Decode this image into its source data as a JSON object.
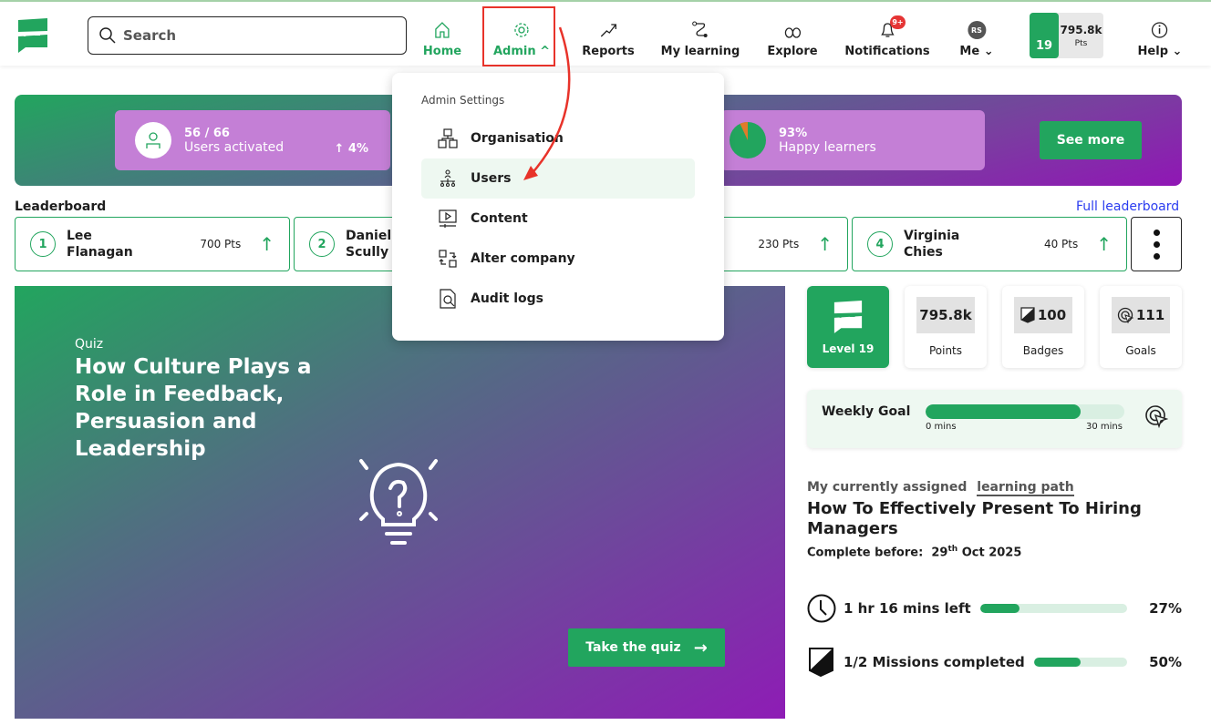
{
  "header": {
    "search_placeholder": "Search",
    "nav": [
      {
        "label": "Home",
        "icon": "home-icon"
      },
      {
        "label": "Admin",
        "icon": "gear-icon"
      },
      {
        "label": "Reports",
        "icon": "trend-icon"
      },
      {
        "label": "My learning",
        "icon": "path-icon"
      },
      {
        "label": "Explore",
        "icon": "binoculars-icon"
      },
      {
        "label": "Notifications",
        "icon": "bell-icon"
      },
      {
        "label": "Me",
        "icon": "avatar"
      },
      {
        "label": "Help",
        "icon": "info-icon"
      }
    ],
    "notifications_badge": "9+",
    "avatar_initials": "RS",
    "level": "19",
    "points": "795.8k",
    "points_unit": "Pts"
  },
  "banner": {
    "users_value": "56 / 66",
    "users_label": "Users activated",
    "users_change": "4%",
    "happy_value": "93%",
    "happy_label": "Happy learners",
    "happy_fraction": 0.93,
    "see_more": "See more"
  },
  "leaderboard": {
    "title": "Leaderboard",
    "full_link": "Full leaderboard",
    "entries": [
      {
        "rank": "1",
        "name": "Lee Flanagan",
        "pts": "700 Pts"
      },
      {
        "rank": "2",
        "name": "Daniel Scully",
        "pts": ""
      },
      {
        "rank": "",
        "name": "",
        "pts": "230 Pts"
      },
      {
        "rank": "4",
        "name": "Virginia Chies",
        "pts": "40 Pts"
      }
    ]
  },
  "quiz": {
    "label": "Quiz",
    "title": "How Culture Plays a Role in Feedback, Persuasion and Leadership",
    "button": "Take the quiz"
  },
  "stats": {
    "level": "Level 19",
    "points": "795.8k",
    "points_label": "Points",
    "badges": "100",
    "badges_label": "Badges",
    "goals": "111",
    "goals_label": "Goals"
  },
  "weekly_goal": {
    "title": "Weekly Goal",
    "min_label": "0 mins",
    "max_label": "30 mins",
    "progress_pct": 78
  },
  "learning_path": {
    "prefix": "My currently assigned",
    "link": "learning path",
    "title": "How To Effectively Present To Hiring Managers",
    "complete_label": "Complete before:",
    "date_day": "29",
    "date_suffix": "th",
    "date_rest": "Oct 2025",
    "time_left": "1 hr 16 mins left",
    "time_pct_label": "27%",
    "time_pct": 27,
    "missions": "1/2 Missions completed",
    "missions_pct_label": "50%",
    "missions_pct": 50
  },
  "admin_menu": {
    "heading": "Admin Settings",
    "items": [
      {
        "label": "Organisation"
      },
      {
        "label": "Users"
      },
      {
        "label": "Content"
      },
      {
        "label": "Alter company"
      },
      {
        "label": "Audit logs"
      }
    ]
  },
  "colors": {
    "brand": "#22a55e",
    "purple": "#c47fd6",
    "annotation": "#e8332a"
  }
}
